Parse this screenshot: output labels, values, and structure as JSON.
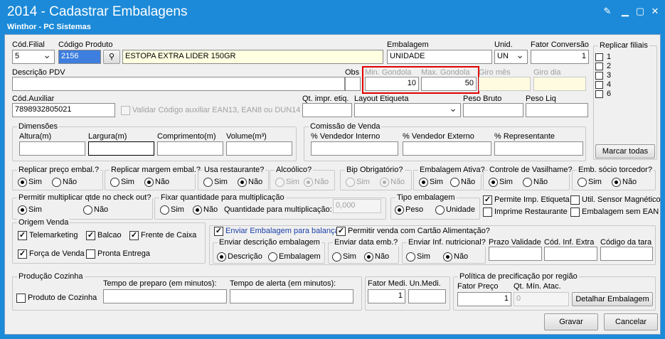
{
  "window": {
    "title": "2014 - Cadastrar Embalagens",
    "subtitle": "Winthor - PC Sistemas"
  },
  "labels": {
    "cod_filial": "Cód.Filial",
    "codigo_produto": "Código Produto",
    "embalagem": "Embalagem",
    "unid": "Unid.",
    "fator_conversao": "Fator Conversão",
    "replicar_filiais": "Replicar filiais",
    "descricao_pdv": "Descrição PDV",
    "obs": "Obs",
    "min_gondola": "Min. Gondola",
    "max_gondola": "Max. Gondola",
    "giro_mes": "Giro mês",
    "giro_dia": "Giro dia",
    "cod_auxiliar": "Cód.Auxiliar",
    "validar_codigo": "Validar Código auxiliar EAN13, EAN8 ou DUN14",
    "qt_impr_etiq": "Qt. impr. etiq.",
    "layout_etiqueta": "Layout Etiqueta",
    "peso_bruto": "Peso Bruto",
    "peso_liq": "Peso Liq",
    "dimensoes": "Dimensões",
    "altura": "Altura(m)",
    "largura": "Largura(m)",
    "comprimento": "Comprimento(m)",
    "volume": "Volume(m³)",
    "comissao_venda": "Comissão de Venda",
    "vend_interno": "% Vendedor Interno",
    "vend_externo": "% Vendedor Externo",
    "representante": "% Representante",
    "replicar_preco": "Replicar preço embal.?",
    "replicar_margem": "Replicar margem embal.?",
    "usa_restaurante": "Usa restaurante?",
    "alcoolico": "Alcoólico?",
    "bip_obrigatorio": "Bip Obrigatório?",
    "embalagem_ativa": "Embalagem Ativa?",
    "controle_vasilhame": "Controle de Vasilhame?",
    "emb_socio_torcedor": "Emb. sócio torcedor?",
    "permitir_multiplicar": "Permitir multiplicar qtde no check out?",
    "fixar_quantidade": "Fixar quantidade para multiplicação",
    "quantidade_multiplicacao": "Quantidade para multiplicação:",
    "tipo_embalagem": "Tipo embalagem",
    "origem_venda": "Origem Venda",
    "enviar_desc_embalagem": "Enviar descrição embalagem",
    "enviar_data_emb": "Enviar data emb.?",
    "enviar_inf_nutricional": "Enviar Inf. nutricional?",
    "prazo_validade": "Prazo Validade",
    "cod_inf_extra": "Cód. Inf. Extra",
    "codigo_tara": "Código da tara",
    "producao_cozinha": "Produção Cozinha",
    "tempo_preparo": "Tempo de preparo (em minutos):",
    "tempo_alerta": "Tempo de alerta (em minutos):",
    "fator_medi": "Fator Medi. Un.Medi.",
    "politica_precificacao": "Política de precificação por região",
    "fator_preco": "Fator Preço",
    "qt_min_atac": "Qt. Mín. Atac.",
    "sim": "Sim",
    "nao": "Não",
    "peso": "Peso",
    "unidade": "Unidade",
    "descricao": "Descrição",
    "embalagem_opt": "Embalagem"
  },
  "values": {
    "cod_filial": "5",
    "codigo_produto": "2156",
    "produto_desc": "ESTOPA EXTRA LIDER 150GR",
    "embalagem": "UNIDADE",
    "unid": "UN",
    "fator_conversao": "1",
    "descricao_pdv": "",
    "min_gondola": "10",
    "max_gondola": "50",
    "cod_auxiliar": "7898932805021",
    "quantidade_multiplicacao": "0,000",
    "fator_medi": "1",
    "fator_preco": "1",
    "qt_min_atac": "0"
  },
  "replicar_filiais": [
    "1",
    "2",
    "3",
    "4",
    "6"
  ],
  "checks": {
    "permite_imp_etiqueta": "Permite Imp. Etiqueta",
    "util_sensor": "Util. Sensor Magnético",
    "imprime_restaurante": "Imprime Restaurante",
    "embalagem_sem_ean": "Embalagem sem EAN",
    "telemarketing": "Telemarketing",
    "balcao": "Balcao",
    "frente_caixa": "Frente de Caixa",
    "forca_venda": "Força de Venda",
    "pronta_entrega": "Pronta Entrega",
    "enviar_embalagem_balanca": "Enviar Embalagem para balança",
    "permitir_venda_cartao": "Permitir venda com Cartão Alimentação?",
    "produto_cozinha": "Produto de Cozinha"
  },
  "buttons": {
    "marcar_todas": "Marcar todas",
    "detalhar_embalagem": "Detalhar Embalagem",
    "gravar": "Gravar",
    "cancelar": "Cancelar"
  },
  "colors": {
    "title_bar": "#1c8ad8",
    "highlight": "#e00000",
    "field_yellow": "#ffffe1"
  }
}
